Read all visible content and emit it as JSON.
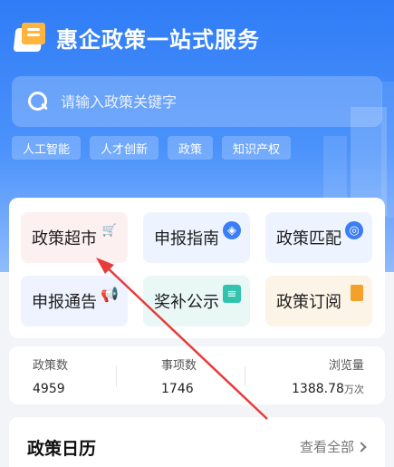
{
  "header": {
    "title": "惠企政策一站式服务"
  },
  "search": {
    "placeholder": "请输入政策关键字"
  },
  "tags": [
    "人工智能",
    "人才创新",
    "政策",
    "知识产权"
  ],
  "tiles": [
    {
      "label": "政策超市",
      "icon": "cart-icon"
    },
    {
      "label": "申报指南",
      "icon": "compass-icon"
    },
    {
      "label": "政策匹配",
      "icon": "match-icon"
    },
    {
      "label": "申报通告",
      "icon": "megaphone-icon"
    },
    {
      "label": "奖补公示",
      "icon": "chat-icon"
    },
    {
      "label": "政策订阅",
      "icon": "bookmark-icon"
    }
  ],
  "stats": [
    {
      "label": "政策数",
      "value": "4959",
      "unit": ""
    },
    {
      "label": "事项数",
      "value": "1746",
      "unit": ""
    },
    {
      "label": "浏览量",
      "value": "1388.78",
      "unit": "万次"
    }
  ],
  "calendar": {
    "title": "政策日历",
    "more": "查看全部"
  },
  "colors": {
    "primary": "#2f7cf6",
    "arrow": "#e83b3b"
  }
}
